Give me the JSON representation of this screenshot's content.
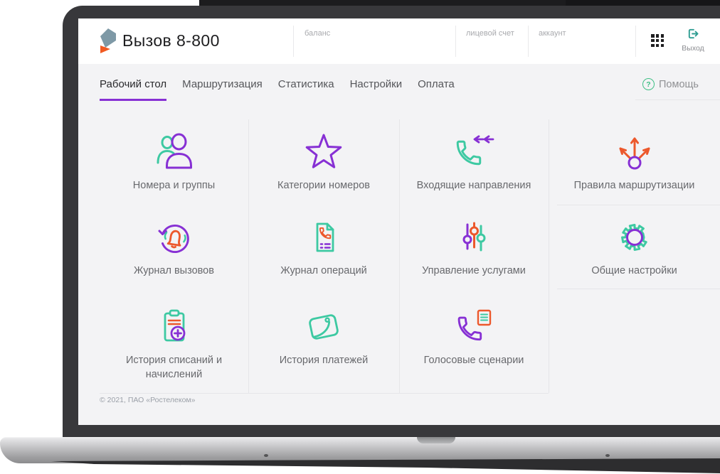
{
  "app": {
    "title": "Вызов 8-800"
  },
  "header": {
    "fields": [
      {
        "label": "баланс"
      },
      {
        "label": "лицевой счет"
      },
      {
        "label": "аккаунт"
      }
    ],
    "logout": {
      "label": "Выход"
    }
  },
  "nav": {
    "tabs": [
      {
        "label": "Рабочий стол",
        "active": true
      },
      {
        "label": "Маршрутизация",
        "active": false
      },
      {
        "label": "Статистика",
        "active": false
      },
      {
        "label": "Настройки",
        "active": false
      },
      {
        "label": "Оплата",
        "active": false
      }
    ],
    "help_label": "Помощь",
    "help_icon_glyph": "?"
  },
  "tiles": [
    {
      "label": "Номера и группы",
      "icon": "users"
    },
    {
      "label": "Категории номеров",
      "icon": "star"
    },
    {
      "label": "Входящие направления",
      "icon": "incoming-call"
    },
    {
      "label": "Правила маршрутизации",
      "icon": "routing-arrows"
    },
    {
      "label": "Журнал вызовов",
      "icon": "call-log"
    },
    {
      "label": "Журнал операций",
      "icon": "operations-log"
    },
    {
      "label": "Управление услугами",
      "icon": "sliders"
    },
    {
      "label": "Общие настройки",
      "icon": "gear"
    },
    {
      "label": "История списаний и начислений",
      "icon": "charges-history"
    },
    {
      "label": "История платежей",
      "icon": "wallet"
    },
    {
      "label": "Голосовые сценарии",
      "icon": "voice-script"
    }
  ],
  "footer": {
    "copyright": "© 2021, ПАО «Ростелеком»"
  },
  "colors": {
    "accent_purple": "#8730d4",
    "accent_mint": "#3dc9a2",
    "accent_orange": "#ec582c",
    "exit_teal": "#2f9d92",
    "help_green": "#3fbf85",
    "brand_slate": "#7e99a6",
    "brand_orange": "#f15a22"
  }
}
